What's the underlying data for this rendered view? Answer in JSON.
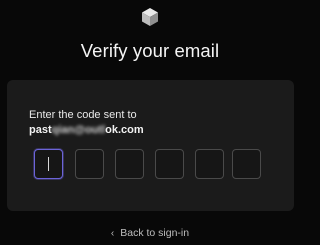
{
  "header": {
    "logo_icon": "box-logo-icon",
    "title": "Verify your email"
  },
  "card": {
    "instruction": "Enter the code sent to",
    "email_visible_start": "past",
    "email_obscured": "qian@outl",
    "email_visible_end": "ok.com",
    "code_length": 6,
    "active_box_index": 0,
    "accent_color": "#6c64d8"
  },
  "footer": {
    "back_icon": "chevron-left-icon",
    "back_chevron": "‹",
    "back_label": "Back to sign-in"
  }
}
